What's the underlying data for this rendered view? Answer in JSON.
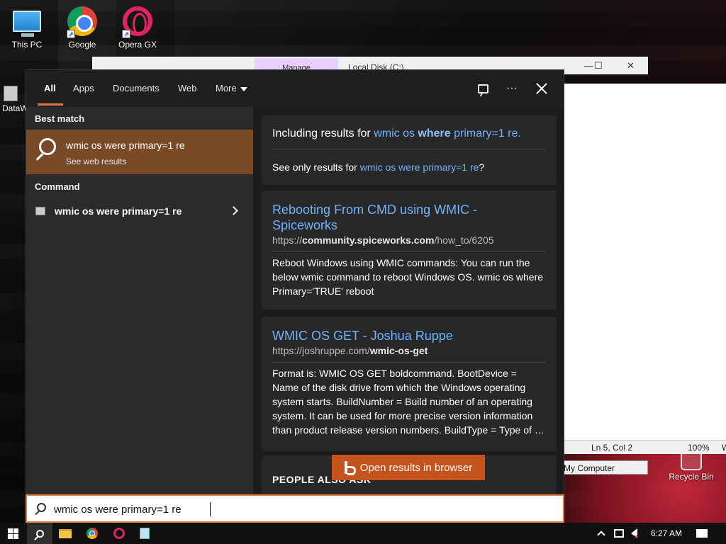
{
  "desktop": {
    "icons": [
      {
        "label": "This PC"
      },
      {
        "label": "Google Chrome"
      },
      {
        "label": "Opera GX Browser"
      },
      {
        "label": "DataW"
      },
      {
        "label": "Recycle Bin"
      }
    ]
  },
  "background_windows": {
    "manage_label": "Manage",
    "title": "Local Disk (C:)",
    "notepad_status": {
      "position": "Ln 5, Col 2",
      "zoom": "100%",
      "extra": "W"
    },
    "my_computer_label": "My Computer",
    "controls": {
      "minimize": "—",
      "maximize": "☐",
      "close": "✕"
    }
  },
  "search_panel": {
    "tabs": [
      {
        "label": "All",
        "active": true
      },
      {
        "label": "Apps"
      },
      {
        "label": "Documents"
      },
      {
        "label": "Web"
      },
      {
        "label": "More"
      }
    ],
    "more_options_glyph": "···",
    "left": {
      "best_match_label": "Best match",
      "best_match": {
        "title": "wmic os were primary=1 re",
        "subtitle": "See web results"
      },
      "command_label": "Command",
      "command": {
        "title": "wmic os were primary=1 re"
      }
    },
    "right": {
      "correction": {
        "including_prefix": "Including results for ",
        "corrected_pre": "wmic os ",
        "corrected_bold": "where",
        "corrected_post": " primary=1 re.",
        "see_only_prefix": "See only results for ",
        "see_only_query": "wmic os were primary=1 re",
        "see_only_suffix": "?"
      },
      "results": [
        {
          "title": "Rebooting From CMD using WMIC - Spiceworks",
          "url_prefix": "https://",
          "url_bold": "community.spiceworks.com",
          "url_suffix": "/how_to/6205",
          "snippet": "Reboot Windows using WMIC commands: You can run the below wmic command to reboot Windows OS. wmic os where Primary='TRUE' reboot"
        },
        {
          "title": "WMIC OS GET - Joshua Ruppe",
          "url_prefix": "https://joshruppe.com/",
          "url_bold": "wmic-os-get",
          "url_suffix": "",
          "snippet": "Format is: WMIC OS GET boldcommand. BootDevice = Name of the disk drive from which the Windows operating system starts. BuildNumber = Build number of an operating system. It can be used for more precise version information than product release version numbers. BuildType = Type of …"
        }
      ],
      "people_also_label": "PEOPLE ALSO ASK"
    },
    "open_in_browser_label": "Open results in browser"
  },
  "search_box": {
    "value": "wmic os were primary=1 re"
  },
  "taskbar": {
    "clock": "6:27 AM"
  },
  "colors": {
    "accent": "#e07a3f",
    "best_match_bg": "#7a4a28",
    "link": "#6fb2ff",
    "panel_bg": "#2b2b2b",
    "results_bg": "#1c1c1c",
    "open_button_bg": "#c4531d"
  }
}
